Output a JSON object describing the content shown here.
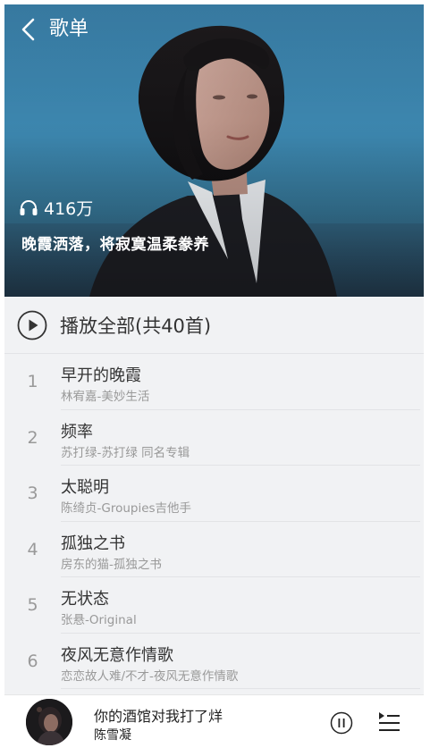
{
  "header": {
    "title": "歌单",
    "back_icon": "chevron-left-icon"
  },
  "hero": {
    "play_count_icon": "headphones-icon",
    "play_count": "416万",
    "description": "晚霞洒落，将寂寞温柔豢养"
  },
  "play_all": {
    "icon": "play-circle-icon",
    "label": "播放全部(共40首)"
  },
  "songs": [
    {
      "index": "1",
      "title": "早开的晚霞",
      "subtitle": "林宥嘉-美妙生活"
    },
    {
      "index": "2",
      "title": "频率",
      "subtitle": "苏打绿-苏打绿 同名专辑"
    },
    {
      "index": "3",
      "title": "太聪明",
      "subtitle": "陈绮贞-Groupies吉他手"
    },
    {
      "index": "4",
      "title": "孤独之书",
      "subtitle": "房东的猫-孤独之书"
    },
    {
      "index": "5",
      "title": "无状态",
      "subtitle": "张悬-Original"
    },
    {
      "index": "6",
      "title": "夜风无意作情歌",
      "subtitle": "恋恋故人难/不才-夜风无意作情歌"
    }
  ],
  "mini_player": {
    "title": "你的酒馆对我打了烊",
    "artist": "陈雪凝",
    "pause_icon": "pause-circle-icon",
    "queue_icon": "playlist-icon"
  },
  "colors": {
    "background": "#f1f2f4",
    "hero_blue": "#3c86ae",
    "primary_text": "#333333",
    "secondary_text": "#999999"
  }
}
